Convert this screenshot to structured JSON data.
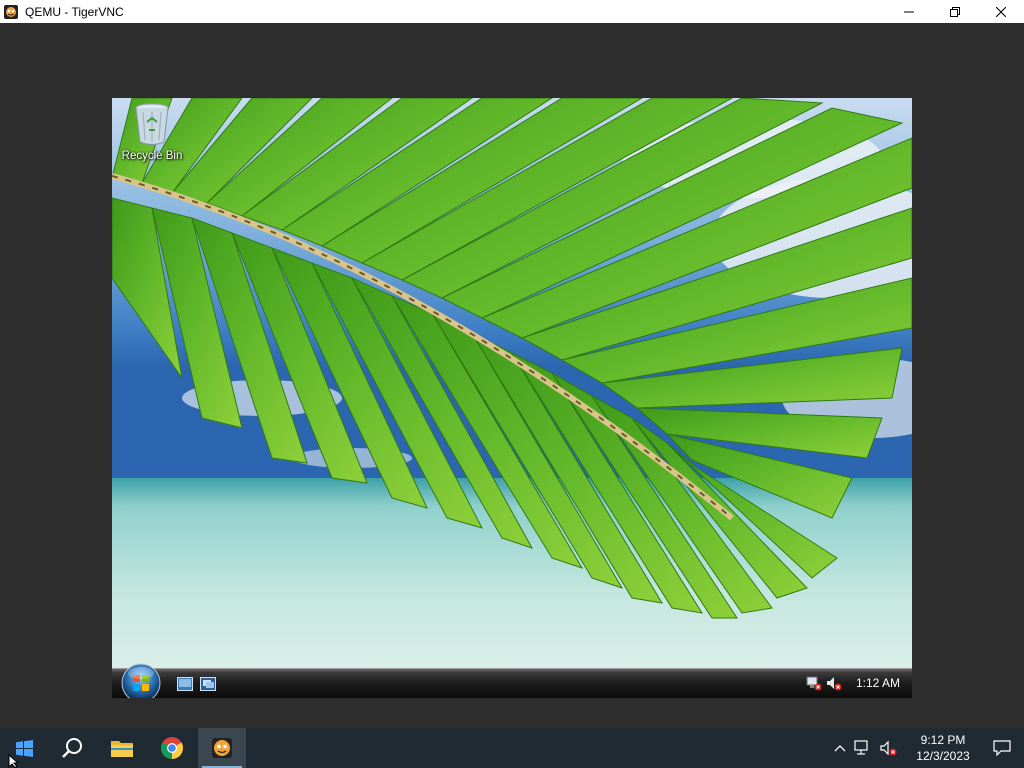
{
  "window": {
    "title": "QEMU - TigerVNC",
    "controls": [
      "minimize",
      "restore",
      "close"
    ]
  },
  "guest": {
    "desktop_icons": [
      {
        "label": "Recycle Bin",
        "icon": "recycle-bin-icon"
      }
    ],
    "taskbar": {
      "start": "vista-start-orb",
      "quick_launch": [
        "show-desktop-icon",
        "switch-windows-icon"
      ],
      "tray_icons": [
        "network-disconnected-icon",
        "volume-muted-icon"
      ],
      "clock": "1:12 AM"
    }
  },
  "host_taskbar": {
    "buttons": [
      {
        "name": "start-button",
        "icon": "windows-logo-icon"
      },
      {
        "name": "search-button",
        "icon": "search-icon"
      },
      {
        "name": "file-explorer-button",
        "icon": "folder-icon"
      },
      {
        "name": "chrome-button",
        "icon": "chrome-icon"
      },
      {
        "name": "tigervnc-button",
        "icon": "tigervnc-icon",
        "active": true
      }
    ],
    "tray_icons": [
      "chevron-up-icon",
      "network-icon",
      "volume-muted-icon"
    ],
    "clock": {
      "time": "9:12 PM",
      "date": "12/3/2023"
    },
    "notification": "action-center-icon"
  },
  "colors": {
    "host_taskbar": "#1f2a33",
    "client_bg": "#2d2d2d",
    "titlebar": "#ffffff"
  }
}
